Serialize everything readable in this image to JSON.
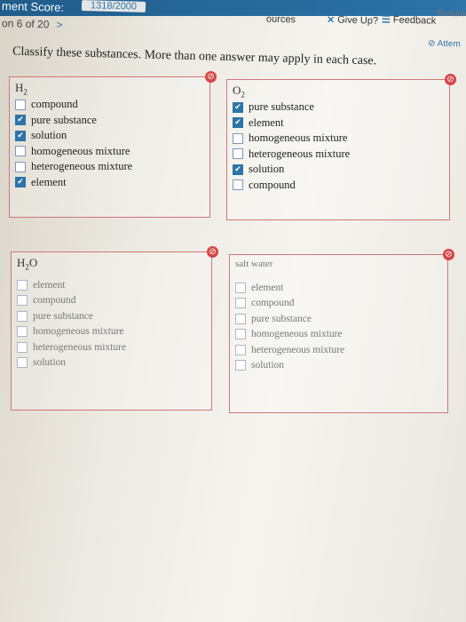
{
  "header": {
    "score_label": "ment Score:",
    "score_value": "1318/2000",
    "question_nav": "on 6 of 20",
    "resources": "ources",
    "give_up": "Give Up?",
    "feedback": "Feedback",
    "resume": "Resume",
    "attempt": "Attem"
  },
  "instruction": "Classify these substances. More than one answer may apply in each case.",
  "cards": [
    {
      "formula_main": "H",
      "formula_sub": "2",
      "options": [
        {
          "label": "compound",
          "checked": false
        },
        {
          "label": "pure substance",
          "checked": true
        },
        {
          "label": "solution",
          "checked": true
        },
        {
          "label": "homogeneous mixture",
          "checked": false
        },
        {
          "label": "heterogeneous mixture",
          "checked": false
        },
        {
          "label": "element",
          "checked": true
        }
      ]
    },
    {
      "formula_main": "O",
      "formula_sub": "2",
      "options": [
        {
          "label": "pure substance",
          "checked": true
        },
        {
          "label": "element",
          "checked": true
        },
        {
          "label": "homogeneous mixture",
          "checked": false
        },
        {
          "label": "heterogeneous mixture",
          "checked": false
        },
        {
          "label": "solution",
          "checked": true
        },
        {
          "label": "compound",
          "checked": false
        }
      ]
    },
    {
      "formula_main": "H",
      "formula_sub": "2",
      "formula_tail": "O",
      "options": [
        {
          "label": "element",
          "checked": false
        },
        {
          "label": "compound",
          "checked": false
        },
        {
          "label": "pure substance",
          "checked": false
        },
        {
          "label": "homogeneous mixture",
          "checked": false
        },
        {
          "label": "heterogeneous mixture",
          "checked": false
        },
        {
          "label": "solution",
          "checked": false
        }
      ]
    },
    {
      "formula_main": "salt water",
      "options": [
        {
          "label": "element",
          "checked": false
        },
        {
          "label": "compound",
          "checked": false
        },
        {
          "label": "pure substance",
          "checked": false
        },
        {
          "label": "homogeneous mixture",
          "checked": false
        },
        {
          "label": "heterogeneous mixture",
          "checked": false
        },
        {
          "label": "solution",
          "checked": false
        }
      ]
    }
  ],
  "colors": {
    "accent": "#2d74a8",
    "error": "#d64545",
    "card_border": "#cc7777"
  },
  "icons": {
    "check": "checkmark-icon",
    "error": "no-entry-icon",
    "chevron": "chevron-right-icon"
  }
}
